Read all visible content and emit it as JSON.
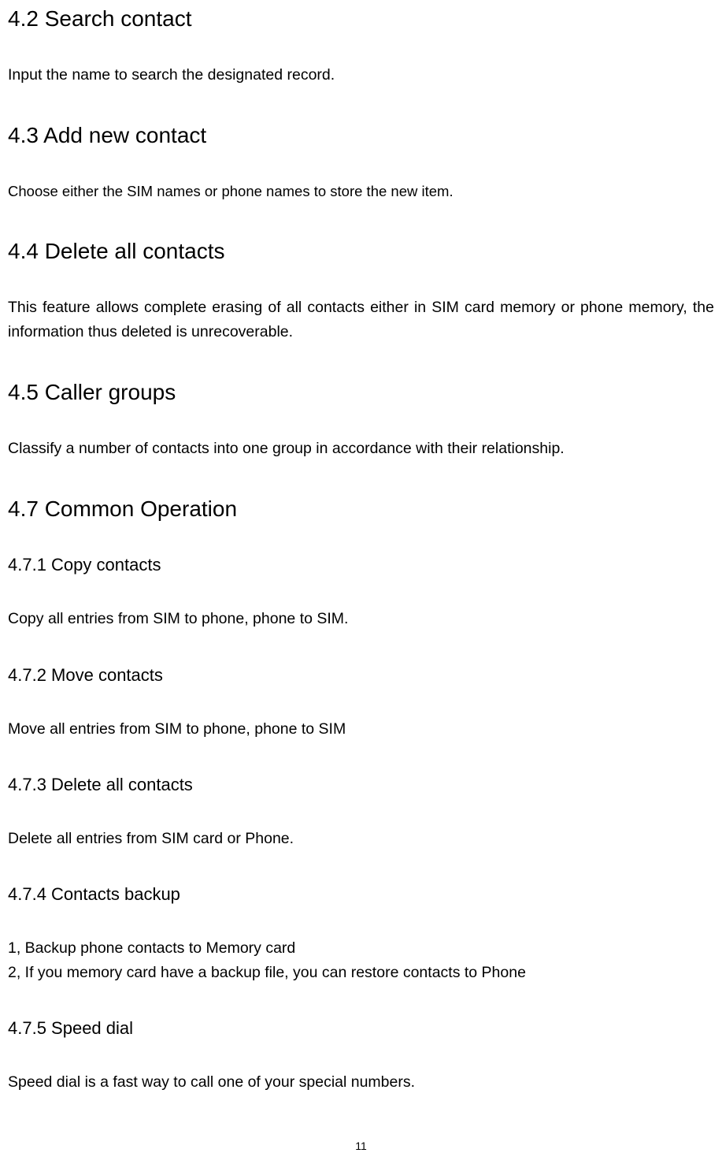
{
  "sections": {
    "s42": {
      "heading": "4.2 Search contact",
      "body": "Input the name to search the designated record."
    },
    "s43": {
      "heading": "4.3 Add new contact",
      "body": "Choose either the SIM names or phone names to store the new item."
    },
    "s44": {
      "heading": "4.4 Delete all contacts",
      "body": "This feature allows complete erasing of all contacts either in SIM card memory or phone memory, the information thus deleted is unrecoverable."
    },
    "s45": {
      "heading": "4.5 Caller groups",
      "body": "Classify a number of contacts into one group in accordance with their relationship."
    },
    "s47": {
      "heading": "4.7 Common Operation"
    },
    "s471": {
      "heading": "4.7.1 Copy contacts",
      "body": "Copy all entries from SIM to phone, phone to SIM."
    },
    "s472": {
      "heading": "4.7.2 Move contacts",
      "body": "Move all entries from SIM to phone, phone to SIM"
    },
    "s473": {
      "heading": "4.7.3 Delete all contacts",
      "body": "Delete all entries from SIM card or Phone."
    },
    "s474": {
      "heading": "4.7.4 Contacts backup",
      "line1": "1, Backup phone contacts to Memory card",
      "line2": "2, If you memory card have a backup file, you can restore contacts to Phone"
    },
    "s475": {
      "heading": "4.7.5 Speed dial",
      "body": "Speed dial is a fast way to call one of your special numbers."
    }
  },
  "page_number": "11"
}
